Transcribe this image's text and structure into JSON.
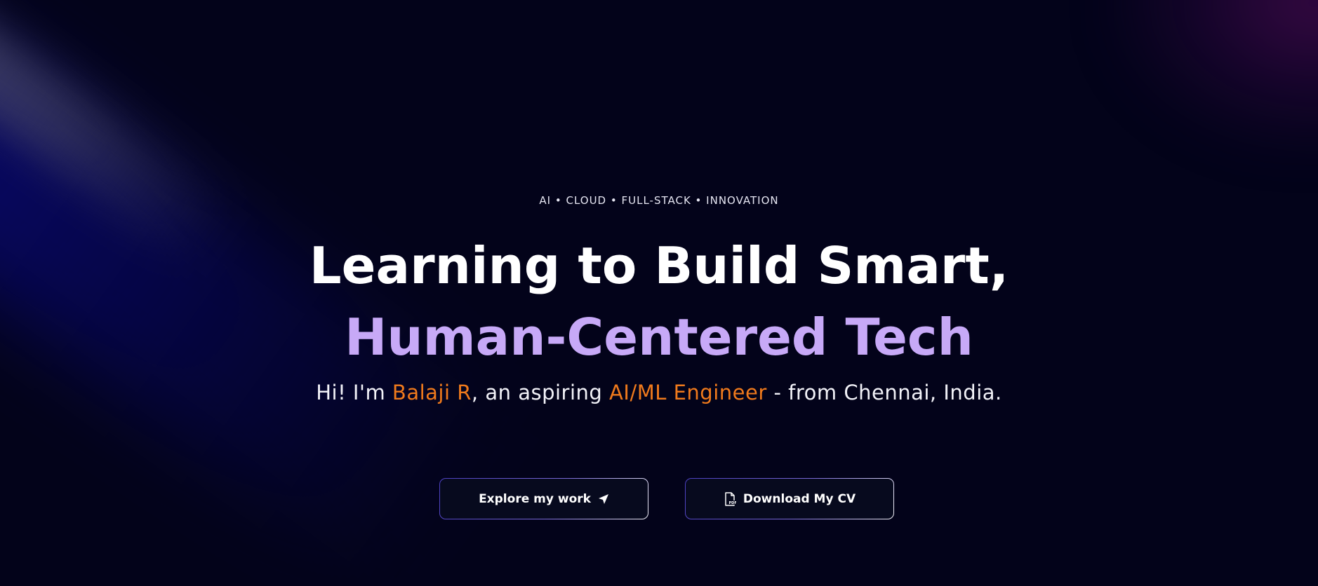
{
  "hero": {
    "eyebrow": "AI • CLOUD • FULL-STACK • INNOVATION",
    "headline_line1": "Learning to Build Smart,",
    "headline_line2": "Human-Centered Tech",
    "intro": {
      "prefix": "Hi! I'm ",
      "name": "Balaji R",
      "middle": ", an aspiring ",
      "role": "AI/ML Engineer",
      "suffix": " - from Chennai, India."
    }
  },
  "buttons": {
    "explore_label": "Explore my work",
    "explore_icon": "send-arrow-icon",
    "cv_label": "Download My CV",
    "cv_icon": "pdf-file-icon"
  },
  "colors": {
    "background": "#03031a",
    "headline_primary": "#ffffff",
    "headline_accent": "#c7a9f7",
    "text_accent": "#f07a1c"
  }
}
